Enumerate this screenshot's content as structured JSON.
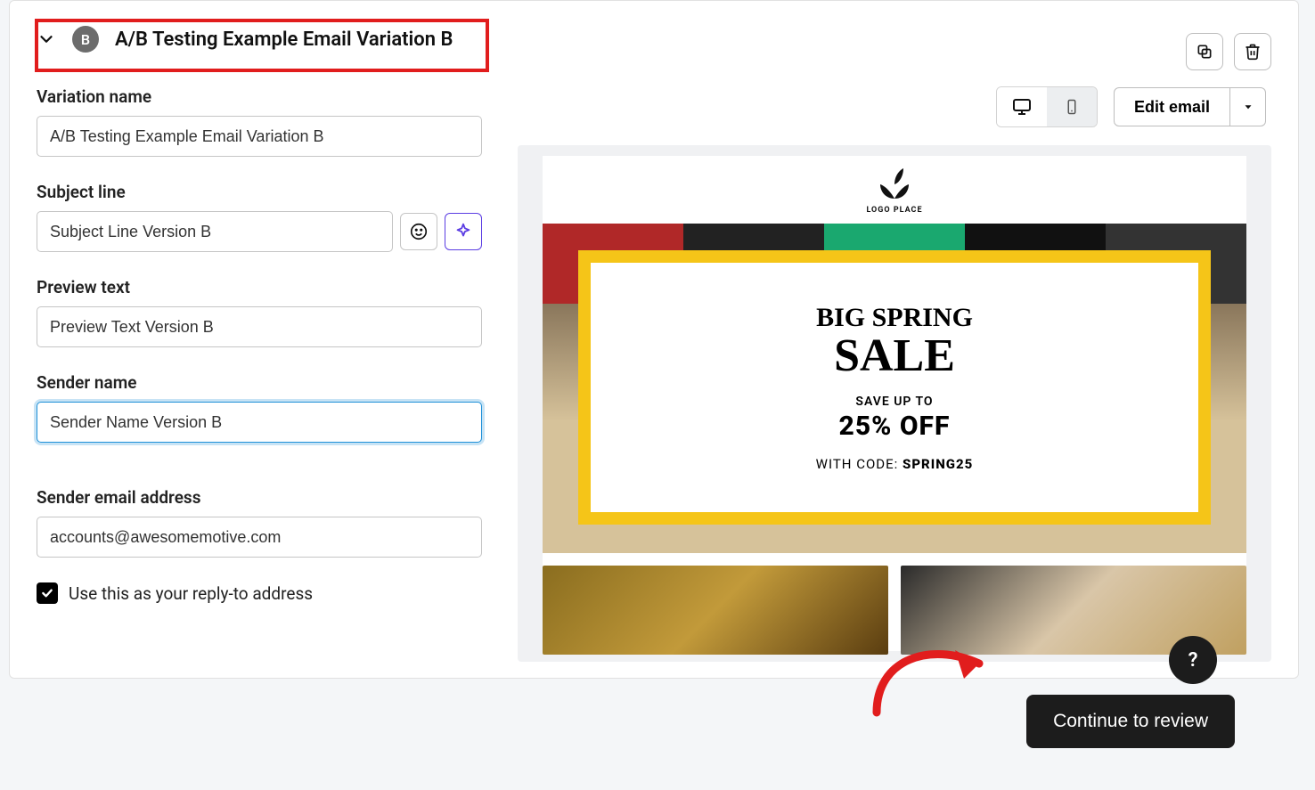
{
  "header": {
    "badge_letter": "B",
    "title": "A/B Testing Example Email Variation B"
  },
  "form": {
    "variation_name": {
      "label": "Variation name",
      "value": "A/B Testing Example Email Variation B"
    },
    "subject_line": {
      "label": "Subject line",
      "value": "Subject Line Version B"
    },
    "preview_text": {
      "label": "Preview text",
      "value": "Preview Text Version B"
    },
    "sender_name": {
      "label": "Sender name",
      "value": "Sender Name Version B"
    },
    "sender_email": {
      "label": "Sender email address",
      "value": "accounts@awesomemotive.com"
    },
    "reply_to_checkbox_label": "Use this as your reply-to address",
    "reply_to_checked": true
  },
  "toolbar": {
    "edit_label": "Edit email"
  },
  "email_preview": {
    "logo_text": "LOGO PLACE",
    "sale_line1": "BIG SPRING",
    "sale_line2": "SALE",
    "save_up_to": "SAVE UP TO",
    "percent_off": "25% OFF",
    "with_code_prefix": "WITH CODE: ",
    "code": "SPRING25"
  },
  "footer": {
    "continue_label": "Continue to review",
    "help_label": "?"
  }
}
